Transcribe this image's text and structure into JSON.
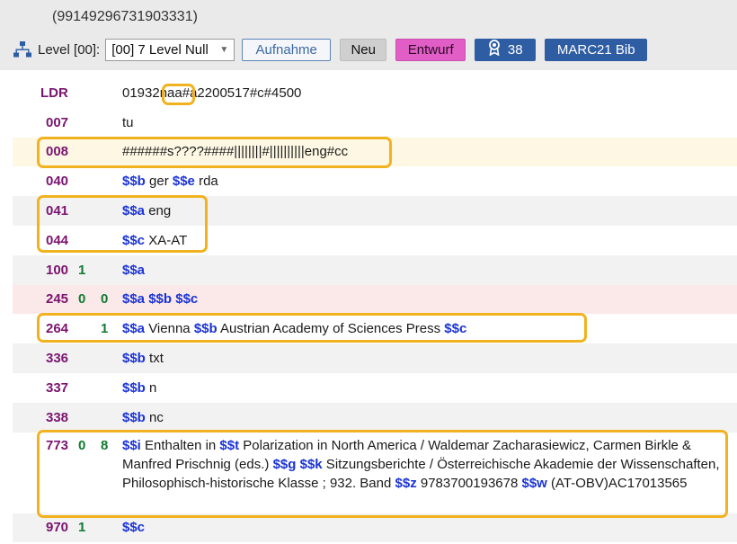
{
  "record": {
    "id": "(99149296731903331)"
  },
  "toolbar": {
    "level_label": "Level [00]:",
    "level_value": "[00] 7 Level Null",
    "aufnahme_label": "Aufnahme",
    "neu_label": "Neu",
    "entwurf_label": "Entwurf",
    "badge_count": "38",
    "marc_label": "MARC21 Bib"
  },
  "fields": [
    {
      "tag": "LDR",
      "ind1": "",
      "ind2": "",
      "parts": [
        {
          "t": "01932naa#a2200517#c#4500"
        }
      ]
    },
    {
      "tag": "007",
      "ind1": "",
      "ind2": "",
      "parts": [
        {
          "t": "tu"
        }
      ]
    },
    {
      "tag": "008",
      "ind1": "",
      "ind2": "",
      "parts": [
        {
          "t": "######s????####||||||||#||||||||||eng#cc"
        }
      ]
    },
    {
      "tag": "040",
      "ind1": "",
      "ind2": "",
      "parts": [
        {
          "sf": "$$b"
        },
        {
          "t": " ger "
        },
        {
          "sf": "$$e"
        },
        {
          "t": " rda"
        }
      ]
    },
    {
      "tag": "041",
      "ind1": "",
      "ind2": "",
      "parts": [
        {
          "sf": "$$a"
        },
        {
          "t": " eng"
        }
      ]
    },
    {
      "tag": "044",
      "ind1": "",
      "ind2": "",
      "parts": [
        {
          "sf": "$$c"
        },
        {
          "t": " XA-AT"
        }
      ]
    },
    {
      "tag": "100",
      "ind1": "1",
      "ind2": "",
      "parts": [
        {
          "sf": "$$a"
        }
      ]
    },
    {
      "tag": "245",
      "ind1": "0",
      "ind2": "0",
      "parts": [
        {
          "sf": "$$a"
        },
        {
          "t": "  "
        },
        {
          "sf": "$$b"
        },
        {
          "t": "  "
        },
        {
          "sf": "$$c"
        }
      ]
    },
    {
      "tag": "264",
      "ind1": "",
      "ind2": "1",
      "parts": [
        {
          "sf": "$$a"
        },
        {
          "t": " Vienna "
        },
        {
          "sf": "$$b"
        },
        {
          "t": " Austrian Academy of Sciences Press "
        },
        {
          "sf": "$$c"
        }
      ]
    },
    {
      "tag": "336",
      "ind1": "",
      "ind2": "",
      "parts": [
        {
          "sf": "$$b"
        },
        {
          "t": " txt"
        }
      ]
    },
    {
      "tag": "337",
      "ind1": "",
      "ind2": "",
      "parts": [
        {
          "sf": "$$b"
        },
        {
          "t": " n"
        }
      ]
    },
    {
      "tag": "338",
      "ind1": "",
      "ind2": "",
      "parts": [
        {
          "sf": "$$b"
        },
        {
          "t": " nc"
        }
      ]
    },
    {
      "tag": "773",
      "ind1": "0",
      "ind2": "8",
      "parts": [
        {
          "sf": "$$i"
        },
        {
          "t": " Enthalten in "
        },
        {
          "sf": "$$t"
        },
        {
          "t": " Polarization in North America / Waldemar Zacharasiewicz, Carmen Birkle & Manfred Prischnig (eds.) "
        },
        {
          "sf": "$$g"
        },
        {
          "t": "  "
        },
        {
          "sf": "$$k"
        },
        {
          "t": " Sitzungsberichte / Österreichische Akademie der Wissenschaften, Philosophisch-historische Klasse ; 932. Band "
        },
        {
          "sf": "$$z"
        },
        {
          "t": " 9783700193678 "
        },
        {
          "sf": "$$w"
        },
        {
          "t": " (AT-OBV)AC17013565"
        }
      ]
    },
    {
      "tag": "970",
      "ind1": "1",
      "ind2": "",
      "parts": [
        {
          "sf": "$$c"
        }
      ]
    }
  ],
  "colors": {
    "tag": "#7a1470",
    "indicator": "#117a33",
    "subfield": "#1a33d6",
    "highlight": "#f1b21f",
    "entwurf": "#e05ec6",
    "primary": "#2f5da3"
  }
}
